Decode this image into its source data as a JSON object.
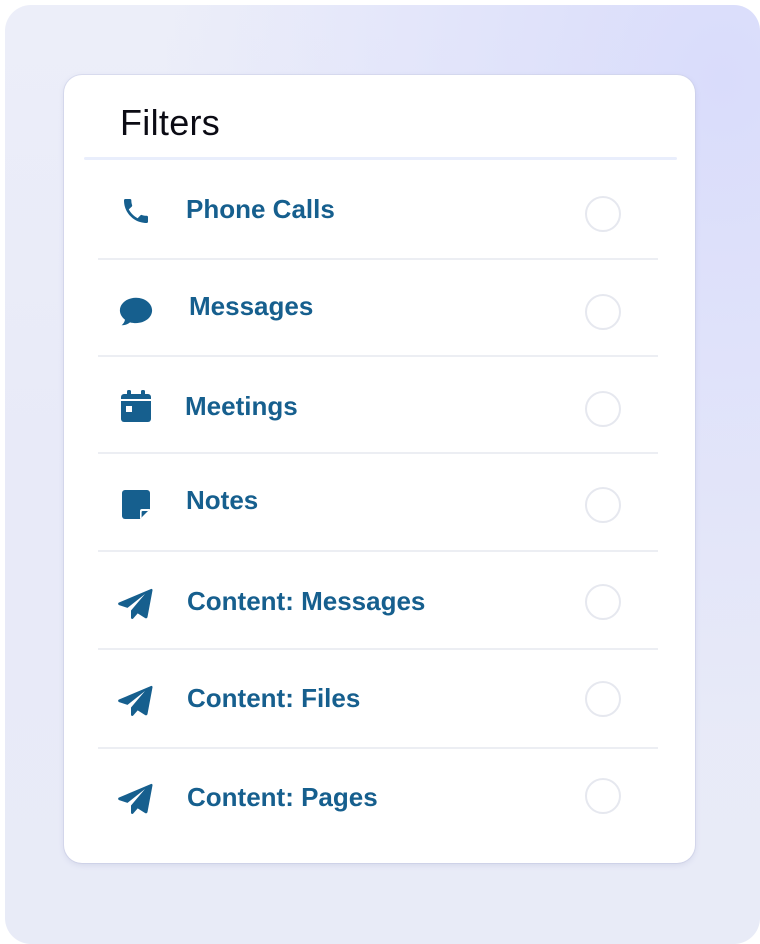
{
  "panel": {
    "title": "Filters"
  },
  "filters": [
    {
      "label": "Phone Calls",
      "icon": "phone-icon",
      "selected": false
    },
    {
      "label": "Messages",
      "icon": "chat-bubble-icon",
      "selected": false
    },
    {
      "label": "Meetings",
      "icon": "calendar-icon",
      "selected": false
    },
    {
      "label": "Notes",
      "icon": "sticky-note-icon",
      "selected": false
    },
    {
      "label": "Content: Messages",
      "icon": "paper-plane-icon",
      "selected": false
    },
    {
      "label": "Content: Files",
      "icon": "paper-plane-icon",
      "selected": false
    },
    {
      "label": "Content: Pages",
      "icon": "paper-plane-icon",
      "selected": false
    }
  ],
  "colors": {
    "accent": "#165f8e",
    "title": "#0b0b14",
    "radio_border": "#e6e8ef",
    "divider": "#eceef3"
  }
}
